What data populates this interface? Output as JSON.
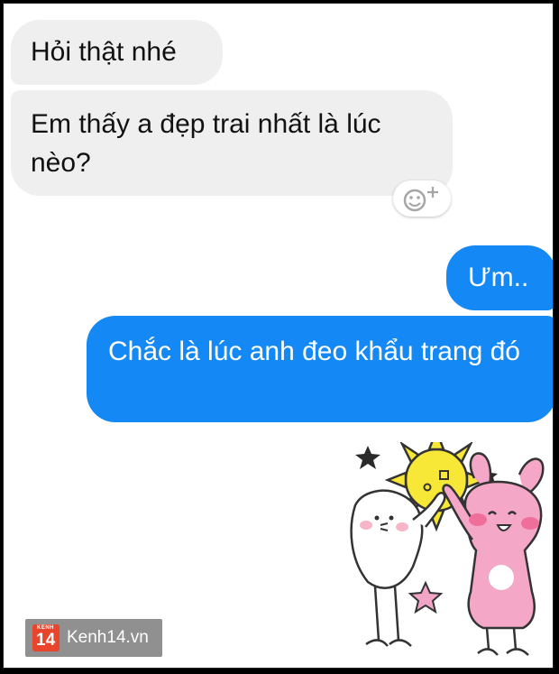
{
  "messages": [
    {
      "side": "received",
      "text": "Hỏi thật nhé"
    },
    {
      "side": "received",
      "text": "Em thấy a đẹp trai nhất là lúc nèo?"
    },
    {
      "side": "sent",
      "text": "Ưm.."
    },
    {
      "side": "sent",
      "text": "Chắc là lúc anh đeo khẩu trang đó"
    }
  ],
  "reaction": {
    "icon": "add-reaction-icon"
  },
  "sticker": {
    "icon": "high-five-sticker"
  },
  "watermark": {
    "logo_small": "KENH",
    "logo_number": "14",
    "text": "Kenh14.vn"
  },
  "colors": {
    "received_bubble": "#efefef",
    "sent_bubble": "#1489f5",
    "sent_text": "#ffffff",
    "watermark_logo": "#e8452c"
  }
}
